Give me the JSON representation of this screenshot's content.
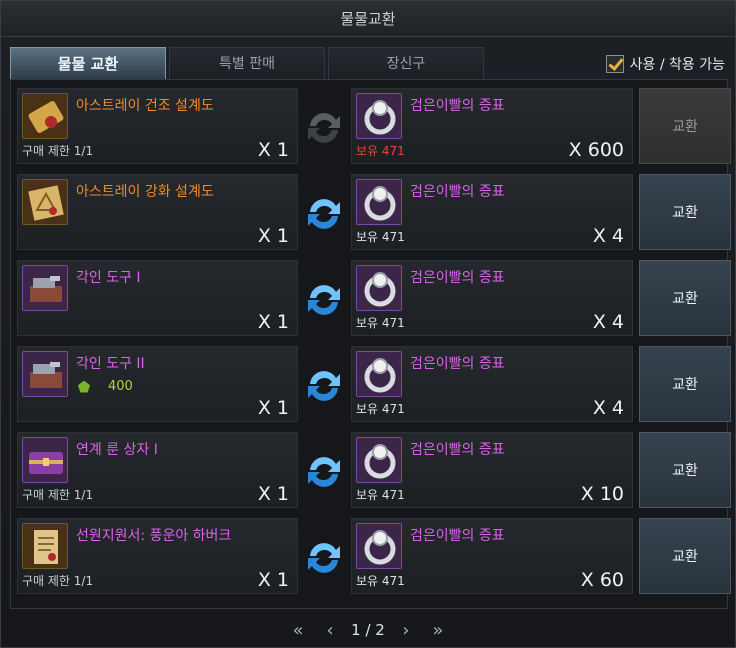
{
  "window": {
    "title": "물물교환"
  },
  "tabs": [
    {
      "label": "물물 교환",
      "active": true
    },
    {
      "label": "특별 판매",
      "active": false
    },
    {
      "label": "장신구",
      "active": false
    }
  ],
  "filter": {
    "label": "사용 / 착용 가능",
    "checked": true
  },
  "colors": {
    "orange_name": "#f08a2c",
    "magenta_name": "#d765e6",
    "insufficient": "#e04a3a",
    "bonus": "#b5d33a"
  },
  "rows": [
    {
      "item": {
        "name": "아스트레이 건조 설계도",
        "color": "orange",
        "icon": "scroll-icon",
        "limit": "구매 제한 1/1",
        "qty": "X 1"
      },
      "cost": {
        "name": "검은이빨의 증표",
        "icon": "ring-icon",
        "owned": "보유 471",
        "insufficient": true,
        "qty": "X 600"
      },
      "button": {
        "label": "교환",
        "enabled": false
      }
    },
    {
      "item": {
        "name": "아스트레이 강화 설계도",
        "color": "orange",
        "icon": "blueprint-icon",
        "limit": "",
        "qty": "X 1"
      },
      "cost": {
        "name": "검은이빨의 증표",
        "icon": "ring-icon",
        "owned": "보유 471",
        "insufficient": false,
        "qty": "X 4"
      },
      "button": {
        "label": "교환",
        "enabled": true
      }
    },
    {
      "item": {
        "name": "각인 도구 I",
        "color": "magenta",
        "icon": "toolbox-icon",
        "limit": "",
        "qty": "X 1"
      },
      "cost": {
        "name": "검은이빨의 증표",
        "icon": "ring-icon",
        "owned": "보유 471",
        "insufficient": false,
        "qty": "X 4"
      },
      "button": {
        "label": "교환",
        "enabled": true
      }
    },
    {
      "item": {
        "name": "각인 도구 II",
        "color": "magenta",
        "icon": "toolbox-icon",
        "limit": "",
        "qty": "X 1",
        "bonus": "400"
      },
      "cost": {
        "name": "검은이빨의 증표",
        "icon": "ring-icon",
        "owned": "보유 471",
        "insufficient": false,
        "qty": "X 4"
      },
      "button": {
        "label": "교환",
        "enabled": true
      }
    },
    {
      "item": {
        "name": "연계 룬 상자 I",
        "color": "magenta",
        "icon": "chest-icon",
        "limit": "구매 제한 1/1",
        "qty": "X 1"
      },
      "cost": {
        "name": "검은이빨의 증표",
        "icon": "ring-icon",
        "owned": "보유 471",
        "insufficient": false,
        "qty": "X 10"
      },
      "button": {
        "label": "교환",
        "enabled": true
      }
    },
    {
      "item": {
        "name": "선원지원서: 풍운아 하버크",
        "color": "magenta",
        "icon": "document-icon",
        "limit": "구매 제한 1/1",
        "qty": "X 1"
      },
      "cost": {
        "name": "검은이빨의 증표",
        "icon": "ring-icon",
        "owned": "보유 471",
        "insufficient": false,
        "qty": "X 60"
      },
      "button": {
        "label": "교환",
        "enabled": true
      }
    }
  ],
  "pager": {
    "label": "1 / 2"
  }
}
